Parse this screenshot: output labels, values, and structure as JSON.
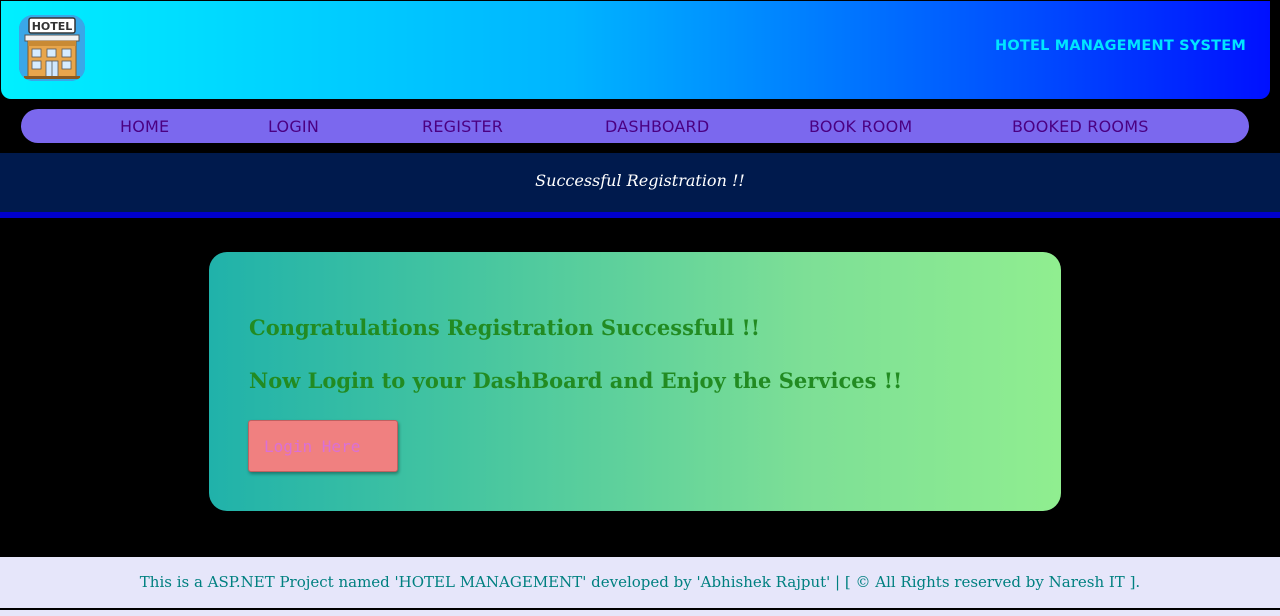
{
  "header": {
    "logo_text": "HOTEL",
    "title": "HOTEL MANAGEMENT SYSTEM"
  },
  "nav": {
    "items": [
      {
        "label": "HOME"
      },
      {
        "label": "LOGIN"
      },
      {
        "label": "REGISTER"
      },
      {
        "label": "DASHBOARD"
      },
      {
        "label": "BOOK ROOM"
      },
      {
        "label": "BOOKED ROOMS"
      }
    ]
  },
  "banner": {
    "text": "Successful Registration !!"
  },
  "card": {
    "line1": "Congratulations Registration Successfull !!",
    "line2": "Now Login to your DashBoard and Enjoy the Services !!",
    "button_label": "Login Here"
  },
  "footer": {
    "text": "This is a ASP.NET Project named 'HOTEL MANAGEMENT' developed by 'Abhishek Rajput' | [ © All Rights reserved by Naresh IT ]."
  },
  "colors": {
    "header_gradient_start": "#00f0ff",
    "header_gradient_end": "#0010ff",
    "header_title": "#00e5ff",
    "nav_background": "#7b68ee",
    "nav_text": "#4b0082",
    "banner_background": "#001a4d",
    "banner_border": "#0000cd",
    "card_gradient_start": "#20b2aa",
    "card_gradient_end": "#90ee90",
    "card_text": "#228b22",
    "button_background": "#f08080",
    "button_text": "#da70d6",
    "footer_background": "#e6e6fa",
    "footer_text": "#008080"
  },
  "icons": {
    "logo": "hotel-building-icon"
  }
}
